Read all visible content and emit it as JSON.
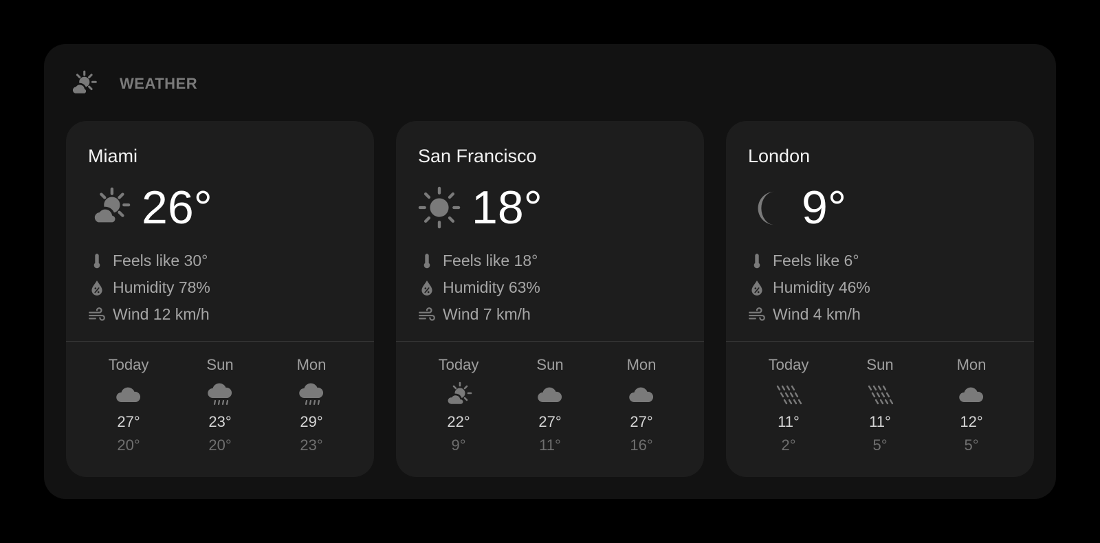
{
  "widget": {
    "title": "WEATHER",
    "icon": "partly-sunny-icon"
  },
  "colors": {
    "page_bg": "#000000",
    "widget_bg": "#121212",
    "card_bg": "#1d1d1d",
    "icon_gray": "#7a7a7a",
    "text_primary": "#f2f2f2",
    "text_secondary": "#a6a6a6"
  },
  "cities": [
    {
      "name": "Miami",
      "temp": "26°",
      "icon": "partly-sunny-icon",
      "feels_like": "Feels like 30°",
      "humidity": "Humidity 78%",
      "wind": "Wind 12 km/h",
      "forecast": [
        {
          "day": "Today",
          "icon": "cloud-icon",
          "high": "27°",
          "low": "20°"
        },
        {
          "day": "Sun",
          "icon": "rain-icon",
          "high": "23°",
          "low": "20°"
        },
        {
          "day": "Mon",
          "icon": "rain-icon",
          "high": "29°",
          "low": "23°"
        }
      ]
    },
    {
      "name": "San Francisco",
      "temp": "18°",
      "icon": "sun-icon",
      "feels_like": "Feels like 18°",
      "humidity": "Humidity 63%",
      "wind": "Wind 7 km/h",
      "forecast": [
        {
          "day": "Today",
          "icon": "partly-sunny-icon",
          "high": "22°",
          "low": "9°"
        },
        {
          "day": "Sun",
          "icon": "cloud-icon",
          "high": "27°",
          "low": "11°"
        },
        {
          "day": "Mon",
          "icon": "cloud-icon",
          "high": "27°",
          "low": "16°"
        }
      ]
    },
    {
      "name": "London",
      "temp": "9°",
      "icon": "moon-icon",
      "feels_like": "Feels like 6°",
      "humidity": "Humidity 46%",
      "wind": "Wind 4 km/h",
      "forecast": [
        {
          "day": "Today",
          "icon": "drizzle-icon",
          "high": "11°",
          "low": "2°"
        },
        {
          "day": "Sun",
          "icon": "drizzle-icon",
          "high": "11°",
          "low": "5°"
        },
        {
          "day": "Mon",
          "icon": "cloud-icon",
          "high": "12°",
          "low": "5°"
        }
      ]
    }
  ]
}
